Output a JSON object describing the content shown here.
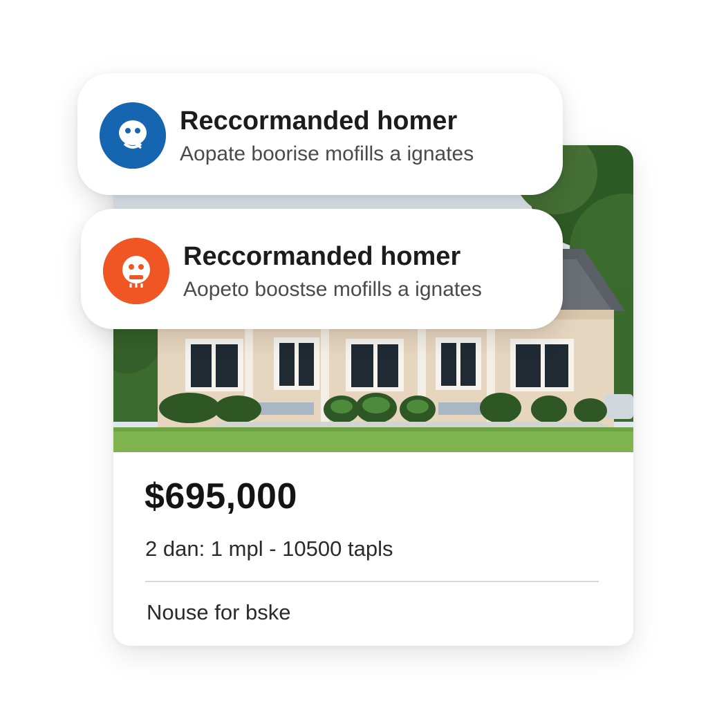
{
  "notifications": [
    {
      "title": "Reccormanded homer",
      "subtitle": "Aopate boorise mofills a ignates",
      "avatar_color": "#1565b0",
      "icon": "face-icon"
    },
    {
      "title": "Reccormanded homer",
      "subtitle": "Aopeto boostse mofills a ignates",
      "avatar_color": "#f05524",
      "icon": "face-icon"
    }
  ],
  "listing": {
    "price": "$695,000",
    "details": "2 dan: 1 mpl - 10500 tapls",
    "type": "Nouse for bske"
  }
}
